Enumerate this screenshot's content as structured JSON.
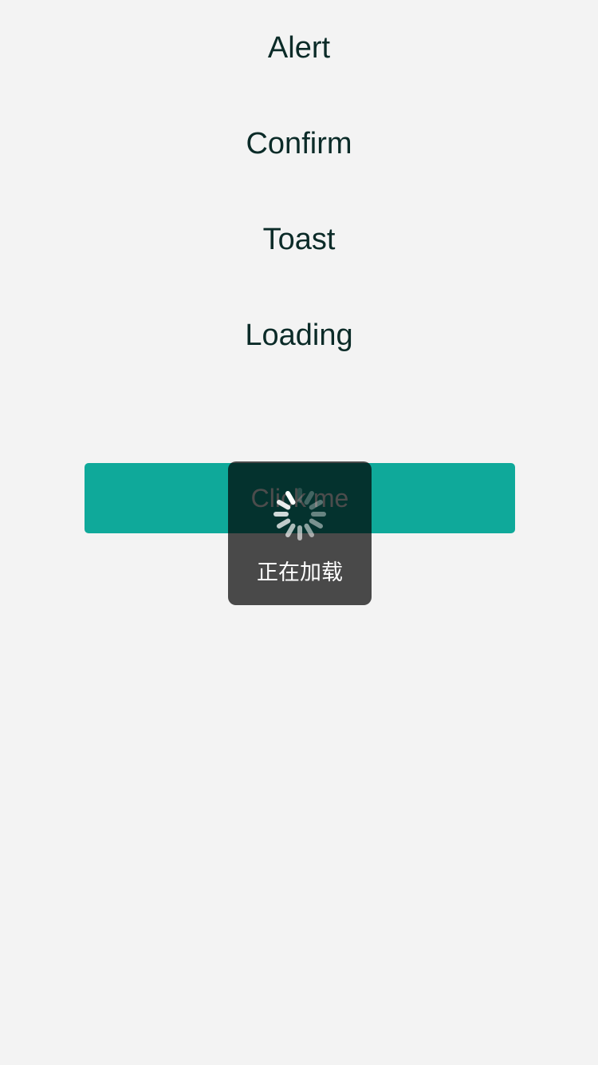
{
  "menu": {
    "items": [
      {
        "label": "Alert"
      },
      {
        "label": "Confirm"
      },
      {
        "label": "Toast"
      },
      {
        "label": "Loading"
      }
    ]
  },
  "main_button": {
    "label": "Click me"
  },
  "loading_toast": {
    "text": "正在加载",
    "icon": "spinner-icon"
  },
  "colors": {
    "background": "#f3f3f3",
    "text": "#0b2b28",
    "accent": "#0fa99a",
    "toast_background": "rgba(0,0,0,0.70)"
  }
}
